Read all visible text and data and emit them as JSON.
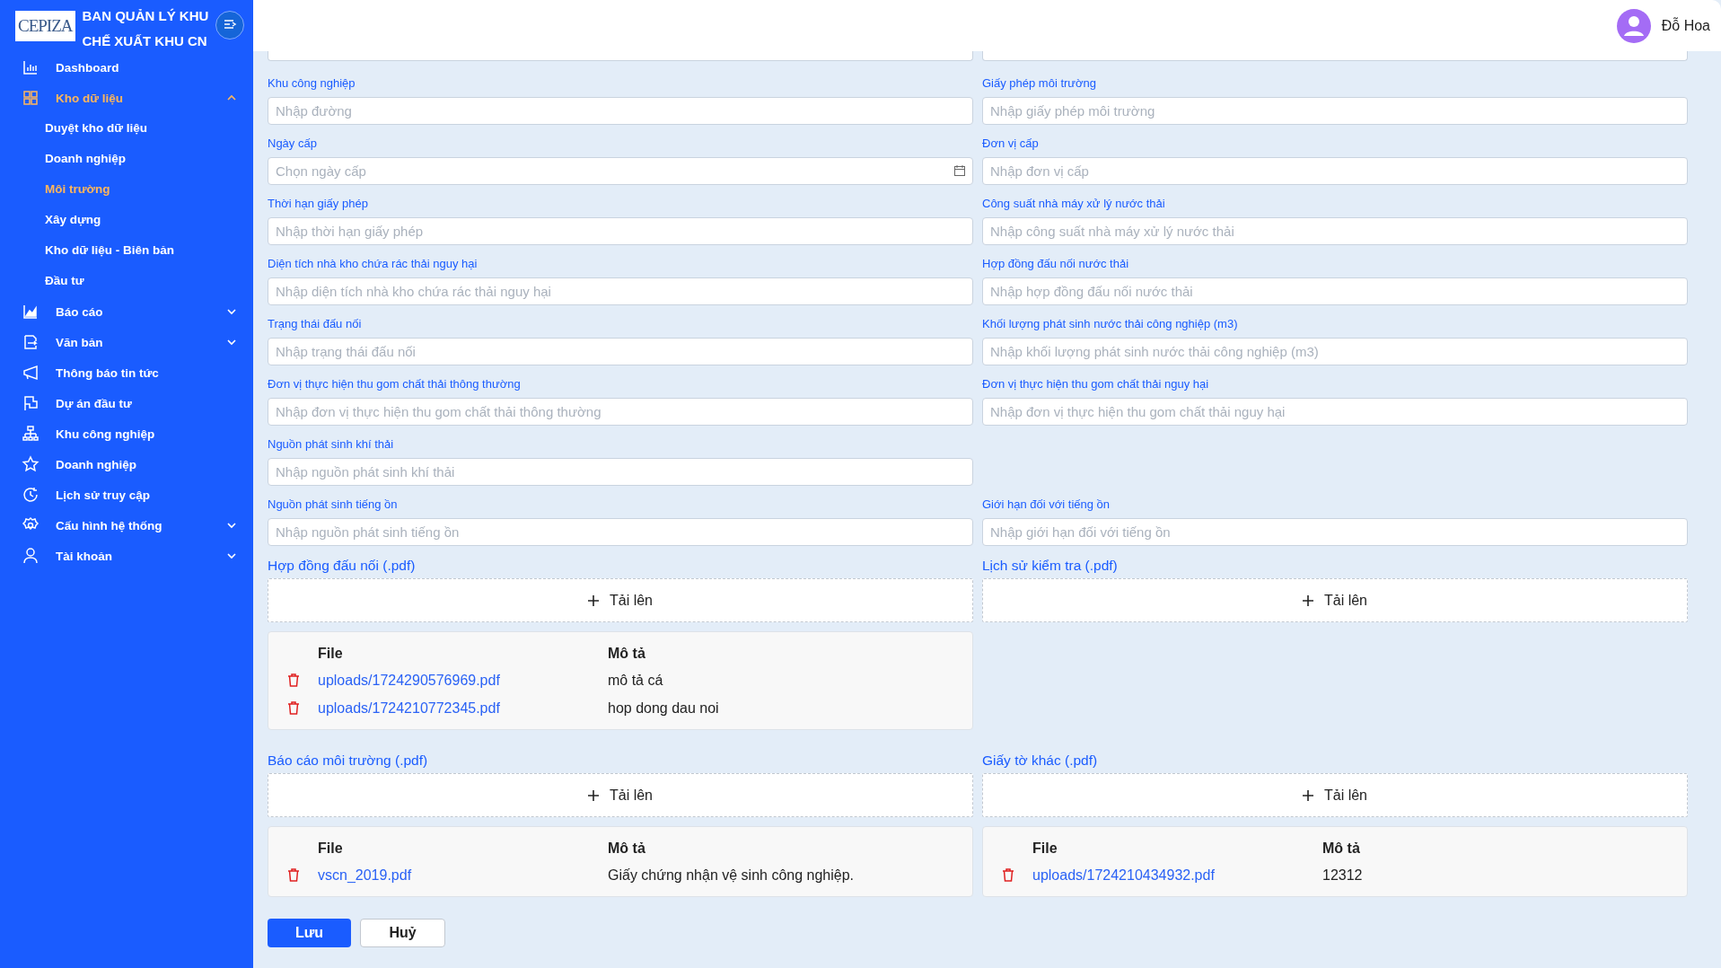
{
  "sidebar": {
    "logo": "CEPIZA",
    "title_lines": [
      "BAN QUẢN LÝ KHU",
      "CHẾ XUẤT KHU CN"
    ],
    "items": [
      {
        "label": "Dashboard",
        "selected": false
      },
      {
        "label": "Kho dữ liệu",
        "selected": true,
        "expanded": true,
        "children": [
          {
            "label": "Duyệt kho dữ liệu",
            "selected": false
          },
          {
            "label": "Doanh nghiệp",
            "selected": false
          },
          {
            "label": "Môi trường",
            "selected": true
          },
          {
            "label": "Xây dựng",
            "selected": false
          },
          {
            "label": "Kho dữ liệu - Biên bản",
            "selected": false
          },
          {
            "label": "Đầu tư",
            "selected": false
          }
        ]
      },
      {
        "label": "Báo cáo",
        "selected": false,
        "expanded": false
      },
      {
        "label": "Văn bản",
        "selected": false,
        "expanded": false
      },
      {
        "label": "Thông báo tin tức",
        "selected": false
      },
      {
        "label": "Dự án đầu tư",
        "selected": false
      },
      {
        "label": "Khu công nghiệp",
        "selected": false
      },
      {
        "label": "Doanh nghiệp",
        "selected": false
      },
      {
        "label": "Lịch sử truy cập",
        "selected": false
      },
      {
        "label": "Cấu hình hệ thống",
        "selected": false,
        "expanded": false
      },
      {
        "label": "Tài khoản",
        "selected": false,
        "expanded": false
      }
    ]
  },
  "header": {
    "user_name": "Đỗ Hoa"
  },
  "form_rows": [
    [
      {
        "label": "Khu công nghiệp",
        "placeholder": "Nhập đường",
        "kind": "text"
      },
      {
        "label": "Giấy phép môi trường",
        "placeholder": "Nhập giấy phép môi trường",
        "kind": "text"
      }
    ],
    [
      {
        "label": "Ngày cấp",
        "placeholder": "Chọn ngày cấp",
        "kind": "date"
      },
      {
        "label": "Đơn vị cấp",
        "placeholder": "Nhập đơn vị cấp",
        "kind": "text"
      }
    ],
    [
      {
        "label": "Thời hạn giấy phép",
        "placeholder": "Nhập thời hạn giấy phép",
        "kind": "text"
      },
      {
        "label": "Công suất nhà máy xử lý nước thải",
        "placeholder": "Nhập công suất nhà máy xử lý nước thải",
        "kind": "text"
      }
    ],
    [
      {
        "label": "Diện tích nhà kho chứa rác thải nguy hại",
        "placeholder": "Nhập diện tích nhà kho chứa rác thải nguy hại",
        "kind": "text"
      },
      {
        "label": "Hợp đồng đấu nối nước thải",
        "placeholder": "Nhập hợp đồng đấu nối nước thải",
        "kind": "text"
      }
    ],
    [
      {
        "label": "Trạng thái đấu nối",
        "placeholder": "Nhập trạng thái đấu nối",
        "kind": "text"
      },
      {
        "label": "Khối lượng phát sinh nước thải công nghiệp (m3)",
        "placeholder": "Nhập khối lượng phát sinh nước thải công nghiệp (m3)",
        "kind": "text"
      }
    ],
    [
      {
        "label": "Đơn vị thực hiện thu gom chất thải thông thường",
        "placeholder": "Nhập đơn vị thực hiện thu gom chất thải thông thường",
        "kind": "text"
      },
      {
        "label": "Đơn vị thực hiện thu gom chất thải nguy hại",
        "placeholder": "Nhập đơn vị thực hiện thu gom chất thải nguy hại",
        "kind": "text"
      }
    ],
    [
      {
        "label": "Nguồn phát sinh khí thải",
        "placeholder": "Nhập nguồn phát sinh khí thải",
        "kind": "text"
      }
    ],
    [
      {
        "label": "Nguồn phát sinh tiếng ồn",
        "placeholder": "Nhập nguồn phát sinh tiếng ồn",
        "kind": "text"
      },
      {
        "label": "Giới hạn đối với tiếng ồn",
        "placeholder": "Nhập giới hạn đối với tiếng ồn",
        "kind": "text"
      }
    ]
  ],
  "upload_rows": [
    [
      {
        "label": "Hợp đồng đấu nối (.pdf)",
        "upload": "Tải lên",
        "columns": [
          "File",
          "Mô tả"
        ],
        "files": [
          {
            "file": "uploads/1724290576969.pdf",
            "description": "mô tả cá"
          },
          {
            "file": "uploads/1724210772345.pdf",
            "description": "hop dong dau noi"
          }
        ]
      },
      {
        "label": "Lịch sử kiểm tra (.pdf)",
        "upload": "Tải lên"
      }
    ],
    [
      {
        "label": "Báo cáo môi trường (.pdf)",
        "upload": "Tải lên",
        "columns": [
          "File",
          "Mô tả"
        ],
        "files": [
          {
            "file": "vscn_2019.pdf",
            "description": "Giấy chứng nhận vệ sinh công nghiệp."
          }
        ]
      },
      {
        "label": "Giấy tờ khác (.pdf)",
        "upload": "Tải lên",
        "columns": [
          "File",
          "Mô tả"
        ],
        "files": [
          {
            "file": "uploads/1724210434932.pdf",
            "description": "12312"
          }
        ]
      }
    ]
  ],
  "actions": {
    "save": "Lưu",
    "cancel": "Huỷ"
  }
}
